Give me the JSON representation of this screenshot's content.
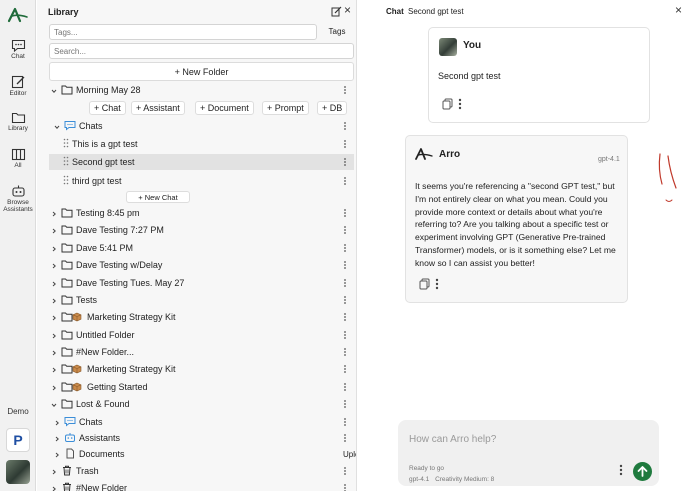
{
  "rail": {
    "items": [
      {
        "label": "Chat",
        "icon": "chat-icon"
      },
      {
        "label": "Editor",
        "icon": "editor-icon"
      },
      {
        "label": "Library",
        "icon": "library-icon"
      },
      {
        "label": "All",
        "icon": "columns-icon"
      },
      {
        "label": "Browse Assistants",
        "icon": "robot-icon"
      }
    ],
    "demo_label": "Demo",
    "p_badge": "P"
  },
  "library": {
    "title": "Library",
    "tags_placeholder": "Tags...",
    "tags_button": "Tags",
    "search_placeholder": "Search...",
    "new_folder": "+ New Folder",
    "chips": [
      "+ Chat",
      "+ Assistant",
      "+ Document",
      "+ Prompt",
      "+ DB"
    ],
    "new_chat": "+ New Chat",
    "upload": "Upload",
    "tree": [
      {
        "label": "Morning May 28",
        "type": "folder",
        "expanded": true
      },
      {
        "label": "Chats",
        "type": "chats",
        "expanded": true
      },
      {
        "label": "This is a gpt test",
        "type": "chat"
      },
      {
        "label": "Second gpt test",
        "type": "chat",
        "selected": true
      },
      {
        "label": "third gpt test",
        "type": "chat"
      },
      {
        "label": "Testing 8:45 pm",
        "type": "folder"
      },
      {
        "label": "Dave Testing 7:27 PM",
        "type": "folder"
      },
      {
        "label": "Dave 5:41 PM",
        "type": "folder"
      },
      {
        "label": "Dave Testing w/Delay",
        "type": "folder"
      },
      {
        "label": "Dave Testing Tues. May 27",
        "type": "folder"
      },
      {
        "label": "Tests",
        "type": "folder"
      },
      {
        "label": "Marketing Strategy Kit",
        "type": "kit"
      },
      {
        "label": "Untitled Folder",
        "type": "folder"
      },
      {
        "label": "#New Folder...",
        "type": "folder"
      },
      {
        "label": "Marketing Strategy Kit",
        "type": "kit"
      },
      {
        "label": "Getting Started",
        "type": "kit"
      },
      {
        "label": "Lost & Found",
        "type": "folder",
        "expanded": true
      },
      {
        "label": "Chats",
        "type": "chats"
      },
      {
        "label": "Assistants",
        "type": "assistants"
      },
      {
        "label": "Documents",
        "type": "documents"
      },
      {
        "label": "Trash",
        "type": "trash"
      },
      {
        "label": "#New Folder",
        "type": "trash"
      }
    ]
  },
  "chat": {
    "header_label": "Chat",
    "title": "Second gpt test",
    "user": {
      "name": "You",
      "message": "Second gpt test"
    },
    "assistant": {
      "name": "Arro",
      "model": "gpt-4.1",
      "message": "It seems you're referencing a \"second GPT test,\" but I'm not entirely clear on what you mean. Could you provide more context or details about what you're referring to? Are you talking about a specific test or experiment involving GPT (Generative Pre-trained Transformer) models, or is it something else? Let me know so I can assist you better!"
    },
    "composer": {
      "placeholder": "How can Arro help?",
      "status": "Ready to go",
      "model": "gpt-4.1",
      "creativity": "Creativity Medium: 8"
    }
  },
  "colors": {
    "brand_green": "#1f7a3e",
    "selected_row": "#e2e2e2",
    "scribble": "#c0392b"
  }
}
